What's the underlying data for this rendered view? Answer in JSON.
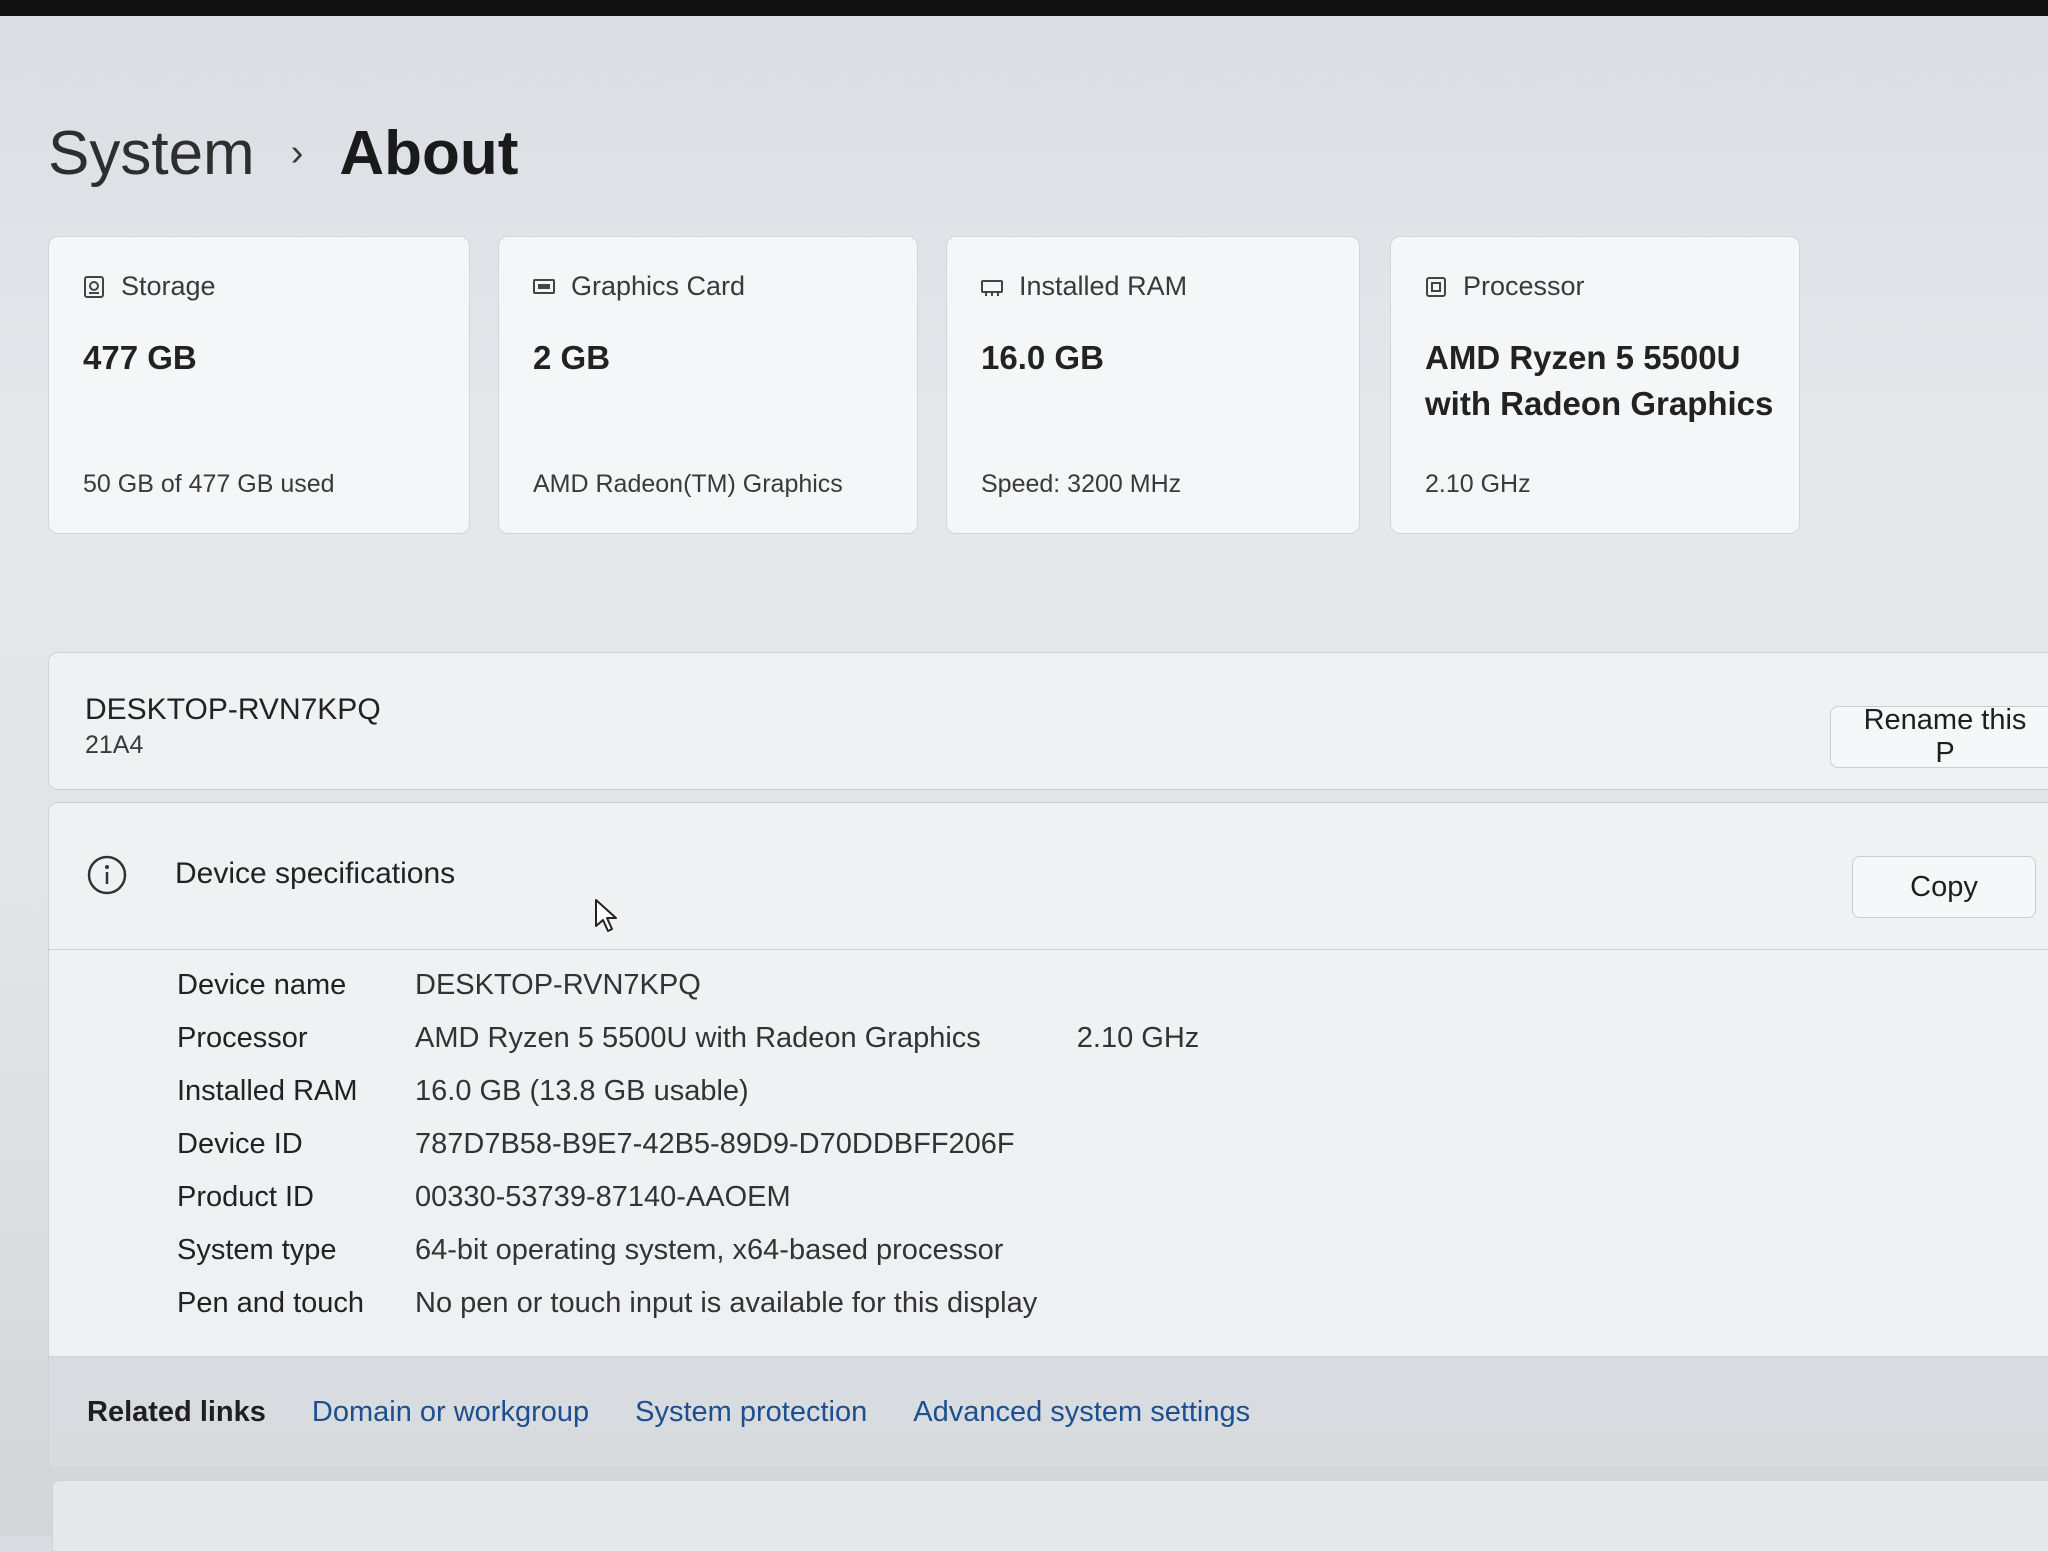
{
  "breadcrumb": {
    "parent": "System",
    "separator": "›",
    "current": "About"
  },
  "cards": [
    {
      "icon": "storage-icon",
      "label": "Storage",
      "value": "477 GB",
      "sub": "50 GB of 477 GB used"
    },
    {
      "icon": "graphics-card-icon",
      "label": "Graphics Card",
      "value": "2 GB",
      "sub": "AMD Radeon(TM) Graphics"
    },
    {
      "icon": "ram-icon",
      "label": "Installed RAM",
      "value": "16.0 GB",
      "sub": "Speed: 3200 MHz"
    },
    {
      "icon": "processor-icon",
      "label": "Processor",
      "value_line1": "AMD Ryzen 5 5500U",
      "value_line2": "with Radeon Graphics",
      "sub": "2.10 GHz"
    }
  ],
  "device": {
    "name": "DESKTOP-RVN7KPQ",
    "model": "21A4",
    "rename_label": "Rename this P"
  },
  "specs": {
    "title": "Device specifications",
    "copy_label": "Copy",
    "rows": [
      {
        "label": "Device name",
        "value": "DESKTOP-RVN7KPQ"
      },
      {
        "label": "Processor",
        "value": "AMD Ryzen 5 5500U with Radeon Graphics",
        "extra": "2.10 GHz"
      },
      {
        "label": "Installed RAM",
        "value": "16.0 GB (13.8 GB usable)"
      },
      {
        "label": "Device ID",
        "value": "787D7B58-B9E7-42B5-89D9-D70DDBFF206F"
      },
      {
        "label": "Product ID",
        "value": "00330-53739-87140-AAOEM"
      },
      {
        "label": "System type",
        "value": "64-bit operating system, x64-based processor"
      },
      {
        "label": "Pen and touch",
        "value": "No pen or touch input is available for this display"
      }
    ]
  },
  "related": {
    "title": "Related links",
    "links": [
      "Domain or workgroup",
      "System protection",
      "Advanced system settings"
    ]
  },
  "colors": {
    "link": "#1c4f8f",
    "text": "#1a1a1a",
    "card_bg": "#f6f7f8"
  }
}
